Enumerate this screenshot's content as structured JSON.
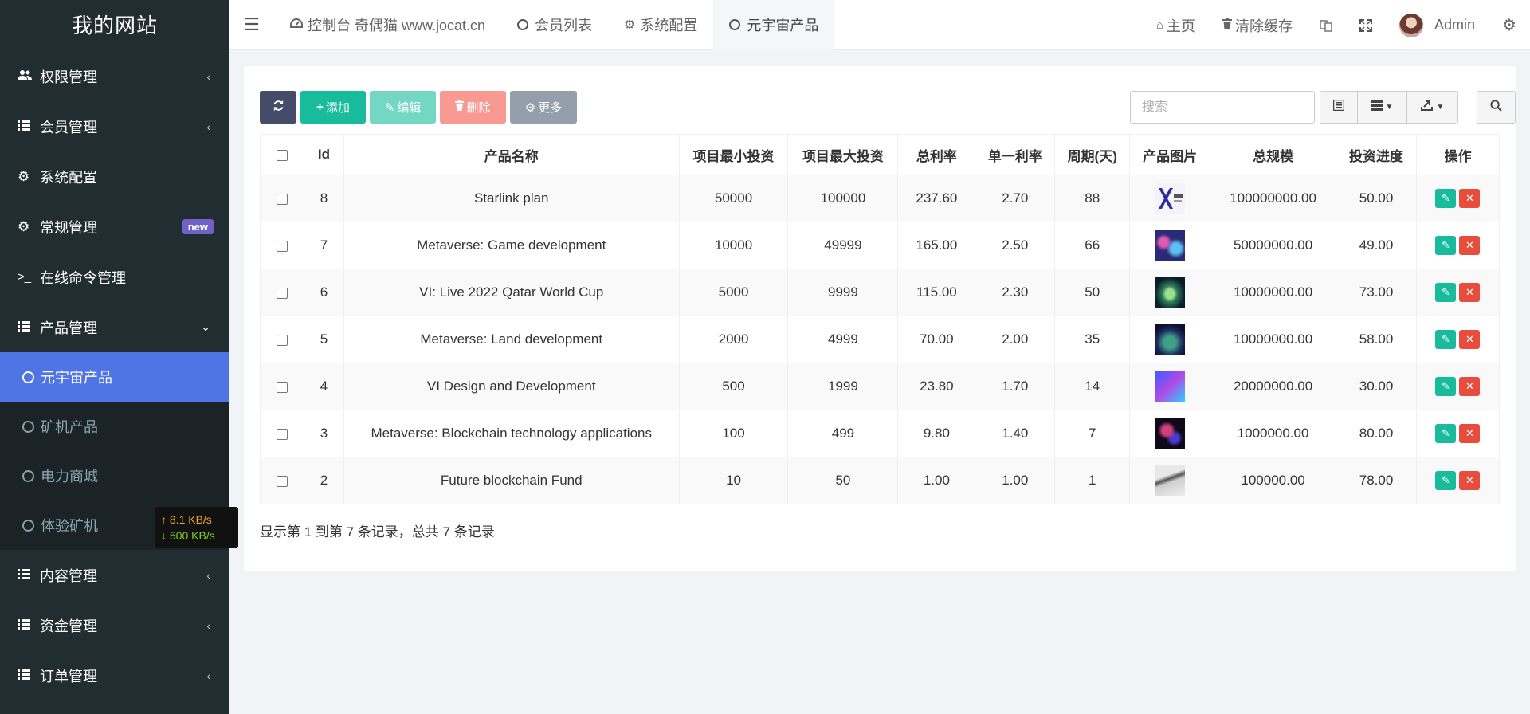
{
  "sidebar": {
    "brand": "我的网站",
    "items": [
      {
        "label": "权限管理",
        "icon": "users-icon",
        "caret": "‹"
      },
      {
        "label": "会员管理",
        "icon": "list-icon",
        "caret": "‹"
      },
      {
        "label": "系统配置",
        "icon": "gear-icon"
      },
      {
        "label": "常规管理",
        "icon": "gears-icon",
        "badge": "new"
      },
      {
        "label": "在线命令管理",
        "icon": "terminal-icon"
      },
      {
        "label": "产品管理",
        "icon": "list-icon",
        "caret": "⌄"
      }
    ],
    "subitems": [
      {
        "label": "元宇宙产品"
      },
      {
        "label": "矿机产品"
      },
      {
        "label": "电力商城"
      },
      {
        "label": "体验矿机"
      }
    ],
    "items_after": [
      {
        "label": "内容管理",
        "icon": "list-icon",
        "caret": "‹"
      },
      {
        "label": "资金管理",
        "icon": "list-icon",
        "caret": "‹"
      },
      {
        "label": "订单管理",
        "icon": "list-icon",
        "caret": "‹"
      }
    ]
  },
  "speed": {
    "up": "↑ 8.1 KB/s",
    "down": "↓ 500 KB/s"
  },
  "topbar": {
    "tabs": [
      {
        "label": "控制台 奇偶猫 www.jocat.cn"
      },
      {
        "label": "会员列表"
      },
      {
        "label": "系统配置"
      },
      {
        "label": "元宇宙产品"
      }
    ],
    "home": "主页",
    "clear_cache": "清除缓存",
    "user": "Admin"
  },
  "toolbar": {
    "add": "添加",
    "edit": "编辑",
    "delete": "删除",
    "more": "更多",
    "search_placeholder": "搜索"
  },
  "table": {
    "headers": [
      "Id",
      "产品名称",
      "项目最小投资",
      "项目最大投资",
      "总利率",
      "单一利率",
      "周期(天)",
      "产品图片",
      "总规模",
      "投资进度",
      "操作"
    ],
    "rows": [
      {
        "id": "8",
        "name": "Starlink plan",
        "min": "50000",
        "max": "100000",
        "total_rate": "237.60",
        "single_rate": "2.70",
        "period": "88",
        "scale": "100000000.00",
        "progress": "50.00"
      },
      {
        "id": "7",
        "name": "Metaverse: Game development",
        "min": "10000",
        "max": "49999",
        "total_rate": "165.00",
        "single_rate": "2.50",
        "period": "66",
        "scale": "50000000.00",
        "progress": "49.00"
      },
      {
        "id": "6",
        "name": "VI: Live 2022 Qatar World Cup",
        "min": "5000",
        "max": "9999",
        "total_rate": "115.00",
        "single_rate": "2.30",
        "period": "50",
        "scale": "10000000.00",
        "progress": "73.00"
      },
      {
        "id": "5",
        "name": "Metaverse: Land development",
        "min": "2000",
        "max": "4999",
        "total_rate": "70.00",
        "single_rate": "2.00",
        "period": "35",
        "scale": "10000000.00",
        "progress": "58.00"
      },
      {
        "id": "4",
        "name": "VI Design and Development",
        "min": "500",
        "max": "1999",
        "total_rate": "23.80",
        "single_rate": "1.70",
        "period": "14",
        "scale": "20000000.00",
        "progress": "30.00"
      },
      {
        "id": "3",
        "name": "Metaverse: Blockchain technology applications",
        "min": "100",
        "max": "499",
        "total_rate": "9.80",
        "single_rate": "1.40",
        "period": "7",
        "scale": "1000000.00",
        "progress": "80.00"
      },
      {
        "id": "2",
        "name": "Future blockchain Fund",
        "min": "10",
        "max": "50",
        "total_rate": "1.00",
        "single_rate": "1.00",
        "period": "1",
        "scale": "100000.00",
        "progress": "78.00"
      }
    ]
  },
  "footer": {
    "summary": "显示第 1 到第 7 条记录，总共 7 条记录"
  },
  "colors": {
    "sidebar_bg": "#222d32",
    "active_menu": "#4f74e3",
    "success": "#18bc9c",
    "danger": "#e74c3c"
  }
}
